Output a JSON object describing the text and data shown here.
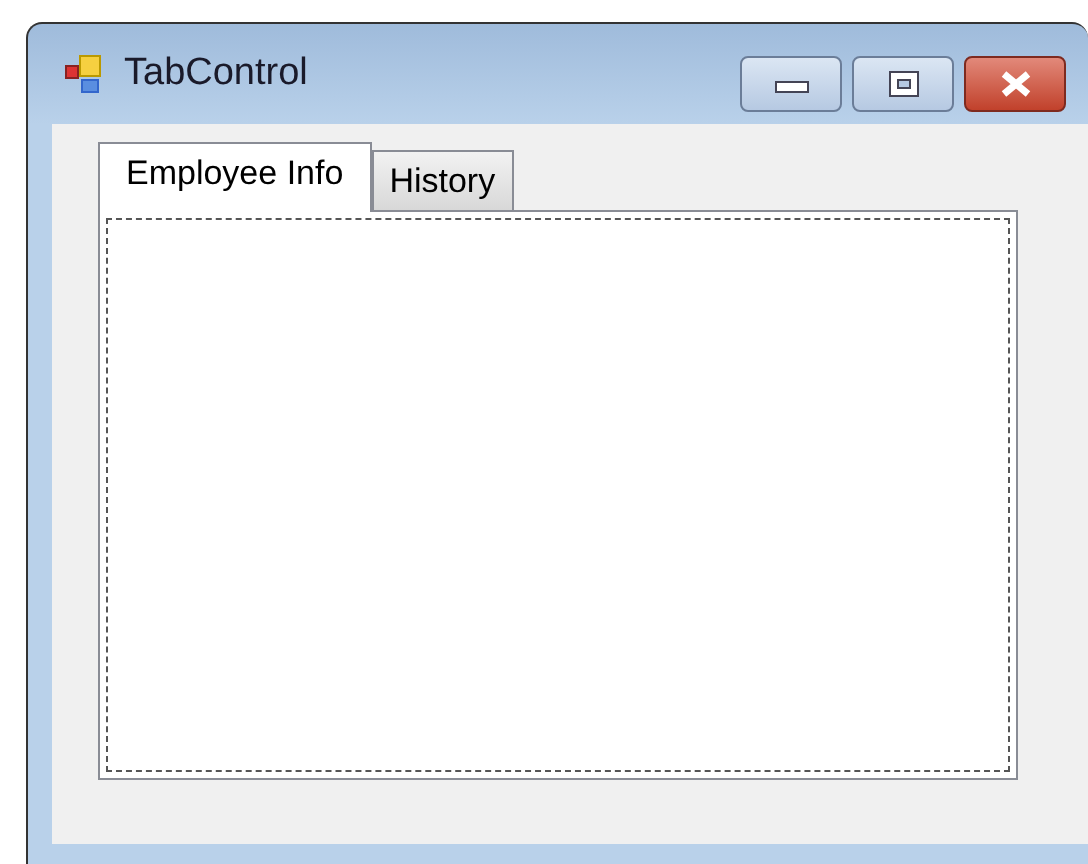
{
  "window": {
    "title": "TabControl"
  },
  "tabs": [
    {
      "label": "Employee Info",
      "selected": true
    },
    {
      "label": "History",
      "selected": false
    }
  ]
}
